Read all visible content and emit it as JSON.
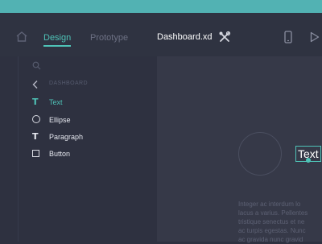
{
  "colors": {
    "accent": "#4fc3b7",
    "top_bar": "#52b2b3",
    "background": "#2e3140",
    "canvas": "#363948"
  },
  "toolbar": {
    "tabs": [
      {
        "label": "Design",
        "active": true
      },
      {
        "label": "Prototype",
        "active": false
      }
    ],
    "document_title": "Dashboard.xd",
    "icons": [
      "home-icon",
      "tools-icon",
      "mobile-device-icon",
      "play-icon"
    ]
  },
  "sidebar": {
    "search_icon": "search-icon",
    "section_label": "DASHBOARD",
    "items": [
      {
        "icon": "text-icon",
        "glyph": "T",
        "label": "Text"
      },
      {
        "icon": "ellipse-icon",
        "label": "Ellipse"
      },
      {
        "icon": "paragraph-icon",
        "glyph": "T",
        "label": "Paragraph"
      },
      {
        "icon": "button-icon",
        "label": "Button"
      }
    ]
  },
  "canvas": {
    "text_element": "Text",
    "paragraph_lines": [
      "Integer ac interdum lo",
      "lacus a varius. Pellentes",
      "tristique senectus et ne",
      "ac turpis egestas. Nunc",
      "ac gravida nunc gravid"
    ]
  }
}
